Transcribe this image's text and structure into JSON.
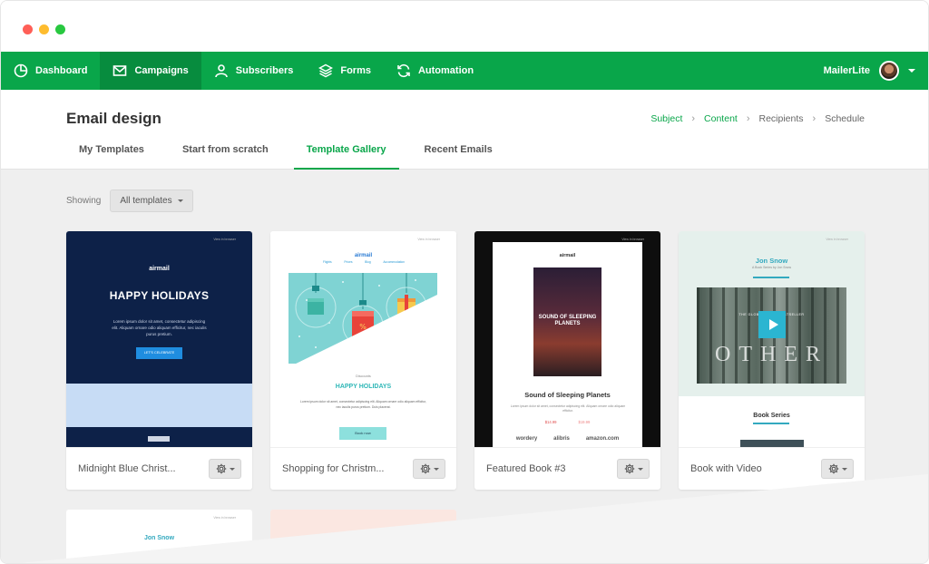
{
  "nav": {
    "items": [
      {
        "label": "Dashboard",
        "icon": "pie-chart-icon"
      },
      {
        "label": "Campaigns",
        "icon": "envelope-icon",
        "active": true
      },
      {
        "label": "Subscribers",
        "icon": "user-icon"
      },
      {
        "label": "Forms",
        "icon": "layers-icon"
      },
      {
        "label": "Automation",
        "icon": "refresh-icon"
      }
    ],
    "account": "MailerLite"
  },
  "header": {
    "title": "Email design",
    "steps": [
      "Subject",
      "Content",
      "Recipients",
      "Schedule"
    ],
    "tabs": [
      "My Templates",
      "Start from scratch",
      "Template Gallery",
      "Recent Emails"
    ],
    "active_tab": "Template Gallery"
  },
  "filter": {
    "label": "Showing",
    "selected": "All templates"
  },
  "templates": [
    {
      "name": "Midnight Blue Christ...",
      "preview": {
        "brand": "airmail",
        "heading": "HAPPY HOLIDAYS",
        "body": "Lorem ipsum dolor sit amet, consectetur adipiscing elit. Aliquam ornare odio aliquam efficitur, nec iaculis purus pretium.",
        "button": "LET'S CELEBRATE"
      }
    },
    {
      "name": "Shopping for Christm...",
      "preview": {
        "brand": "airmail",
        "nav": [
          "Flights",
          "Prices",
          "Blog",
          "Accommodation"
        ],
        "kicker": "Discounts",
        "heading": "HAPPY HOLIDAYS",
        "body": "Lorem ipsum dolor sit amet, consectetur adipiscing elit. Aliquam ornare odio aliquam efficitur, nec iaculis purus pretium. Duis placerat.",
        "button": "Book now"
      }
    },
    {
      "name": "Featured Book #3",
      "preview": {
        "brand": "airmail",
        "cover_title": "SOUND OF SLEEPING PLANETS",
        "title": "Sound of Sleeping Planets",
        "prices": [
          "$14.99",
          "$19.99"
        ],
        "stores": [
          "wordery",
          "alibris",
          "amazon.com"
        ]
      }
    },
    {
      "name": "Book with Video",
      "preview": {
        "author": "Jon Snow",
        "subtitle": "A Book Series by Jon Snow",
        "video_word": "OTHER",
        "video_tag": "THE GLOBAL TIMES BESTSELLER",
        "section": "Book Series"
      }
    }
  ],
  "second_row": {
    "author": "Jon Snow"
  },
  "colors": {
    "brand_green": "#09a64a",
    "nav_active": "#078c3e",
    "content_bg": "#efefef"
  }
}
